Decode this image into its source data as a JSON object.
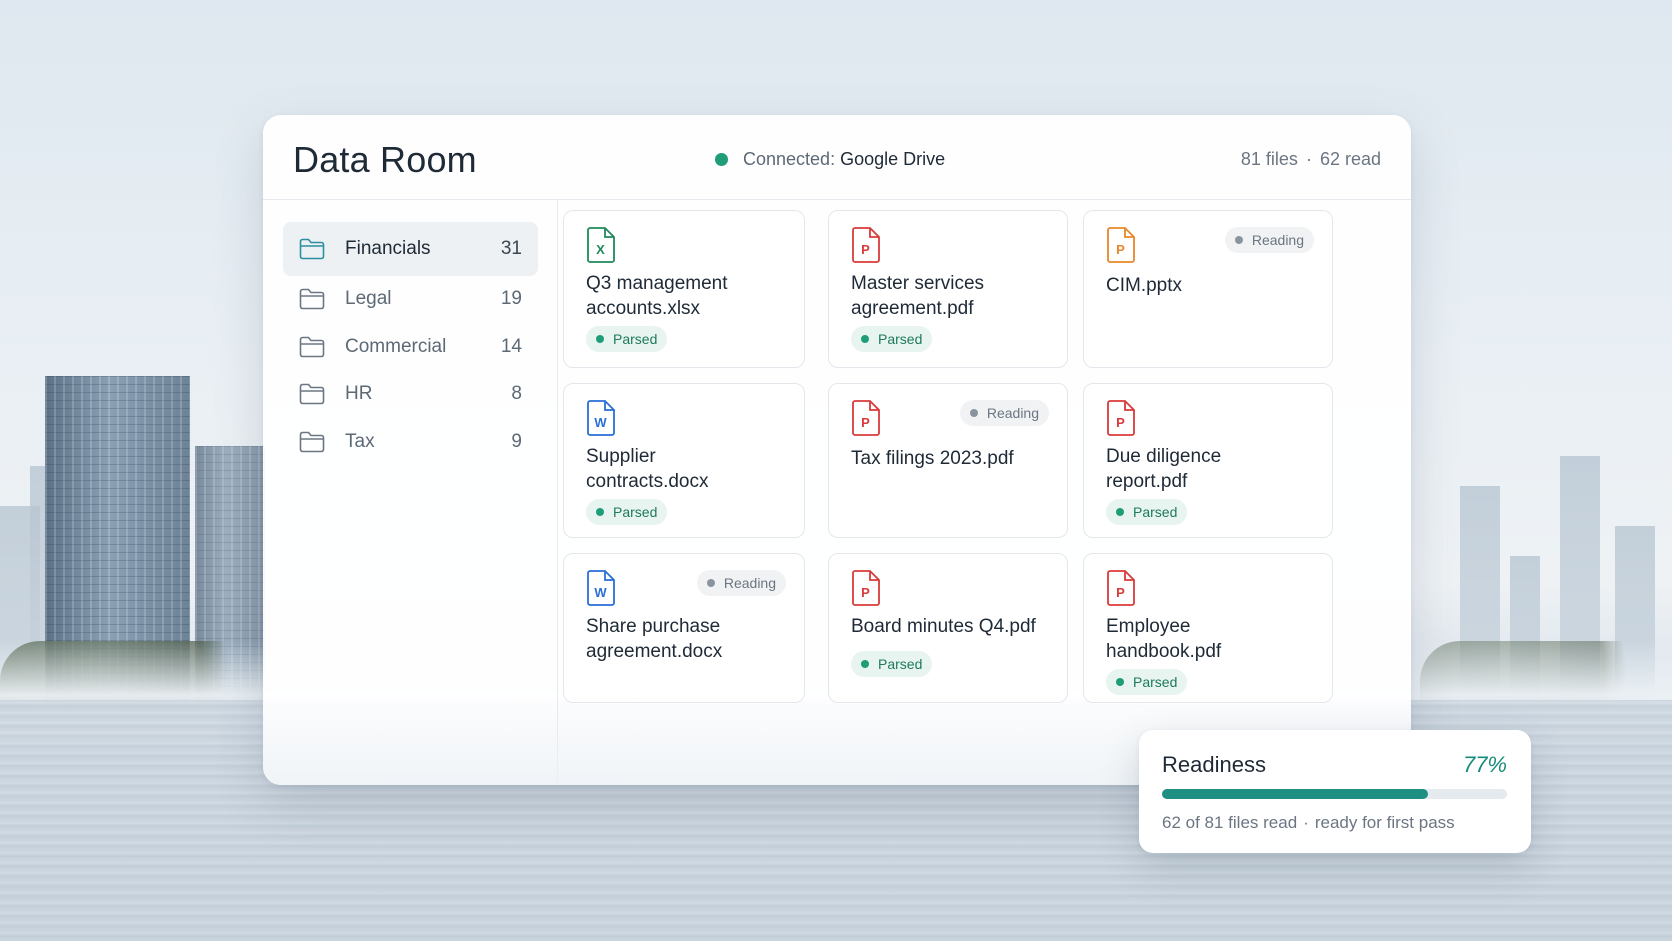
{
  "header": {
    "title": "Data Room",
    "connection_label": "Connected:",
    "connection_service": "Google Drive",
    "file_count": "81 files",
    "separator": "·",
    "read_count": "62 read"
  },
  "sidebar": {
    "folders": [
      {
        "label": "Financials",
        "count": "31",
        "active": true
      },
      {
        "label": "Legal",
        "count": "19",
        "active": false
      },
      {
        "label": "Commercial",
        "count": "14",
        "active": false
      },
      {
        "label": "HR",
        "count": "8",
        "active": false
      },
      {
        "label": "Tax",
        "count": "9",
        "active": false
      }
    ]
  },
  "files": [
    {
      "name": "Q3 management\naccounts.xlsx",
      "type": "xlsx",
      "icon": "spreadsheet-icon",
      "icon_letter": "X",
      "status": "Parsed"
    },
    {
      "name": "Master services\nagreement.pdf",
      "type": "pdf",
      "icon": "pdf-icon",
      "icon_letter": "P",
      "status": "Parsed"
    },
    {
      "name": "CIM.pptx",
      "type": "pptx",
      "icon": "presentation-icon",
      "icon_letter": "P",
      "status": "Reading"
    },
    {
      "name": "Supplier\ncontracts.docx",
      "type": "docx",
      "icon": "document-icon",
      "icon_letter": "W",
      "status": "Parsed"
    },
    {
      "name": "Tax filings 2023.pdf",
      "type": "pdf",
      "icon": "pdf-icon",
      "icon_letter": "P",
      "status": "Reading"
    },
    {
      "name": "Due diligence\nreport.pdf",
      "type": "pdf",
      "icon": "pdf-icon",
      "icon_letter": "P",
      "status": "Parsed"
    },
    {
      "name": "Share purchase\nagreement.docx",
      "type": "docx",
      "icon": "document-icon",
      "icon_letter": "W",
      "status": "Reading"
    },
    {
      "name": "Board minutes Q4.pdf",
      "type": "pdf",
      "icon": "pdf-icon",
      "icon_letter": "P",
      "status": "Parsed"
    },
    {
      "name": "Employee\nhandbook.pdf",
      "type": "pdf",
      "icon": "pdf-icon",
      "icon_letter": "P",
      "status": "Parsed"
    }
  ],
  "readiness": {
    "title": "Readiness",
    "percent_label": "77%",
    "progress": 0.77,
    "files_read": "62 of 81 files read",
    "separator": "·",
    "note": "ready for first pass"
  },
  "colors": {
    "accent": "#1f9d78",
    "progress": "#1f8f84",
    "xlsx": "#1e8a5a",
    "pdf": "#d93a3a",
    "pptx": "#e8872a",
    "docx": "#2a6fd6"
  }
}
